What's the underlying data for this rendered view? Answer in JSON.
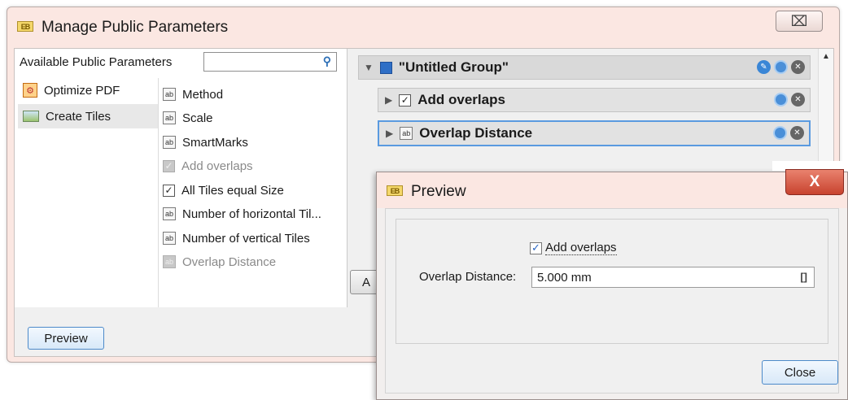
{
  "main_window": {
    "title": "Manage Public Parameters",
    "close_glyph": "⌧"
  },
  "left_panel": {
    "header": "Available Public Parameters",
    "search": {
      "value": "",
      "placeholder": ""
    },
    "categories": [
      {
        "label": "Optimize PDF",
        "icon": "optimize-pdf-icon"
      },
      {
        "label": "Create Tiles",
        "icon": "create-tiles-icon",
        "selected": true
      }
    ],
    "parameters": [
      {
        "label": "Method",
        "icon": "text-field-icon",
        "enabled": true
      },
      {
        "label": "Scale",
        "icon": "text-field-icon",
        "enabled": true
      },
      {
        "label": "SmartMarks",
        "icon": "text-field-icon",
        "enabled": true
      },
      {
        "label": "Add overlaps",
        "icon": "checkbox-icon",
        "enabled": false
      },
      {
        "label": "All Tiles equal Size",
        "icon": "checkbox-icon",
        "enabled": true
      },
      {
        "label": "Number of horizontal Til...",
        "icon": "text-field-icon",
        "enabled": true
      },
      {
        "label": "Number of vertical Tiles",
        "icon": "text-field-icon",
        "enabled": true
      },
      {
        "label": "Overlap Distance",
        "icon": "text-field-icon",
        "enabled": false
      }
    ]
  },
  "right_panel": {
    "group_label": "\"Untitled Group\"",
    "items": [
      {
        "label": "Add overlaps",
        "icon": "checkbox-icon"
      },
      {
        "label": "Overlap Distance",
        "icon": "text-field-icon",
        "selected": true
      }
    ],
    "partial_button_label": "A"
  },
  "footer": {
    "preview_button": "Preview"
  },
  "preview_window": {
    "title": "Preview",
    "close_glyph": "X",
    "checkbox_label": "Add overlaps",
    "checkbox_checked": true,
    "distance_label": "Overlap Distance:",
    "distance_value": "5.000 mm",
    "unit_glyph": "[]",
    "close_button": "Close"
  },
  "colors": {
    "title_bar": "#fbe7e2",
    "accent_blue": "#4a8fd8",
    "close_red": "#c8432f"
  }
}
